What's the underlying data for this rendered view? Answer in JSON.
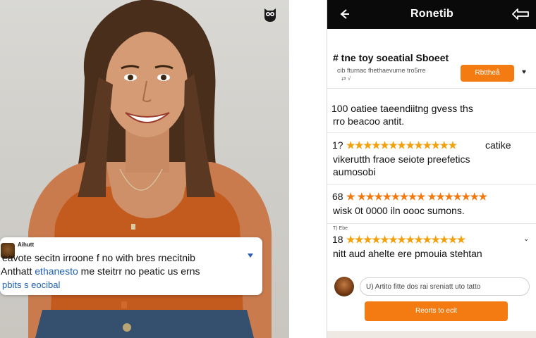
{
  "photo_panel": {
    "comment": {
      "author": "Aihutt",
      "line1": "eavote secitn irroone f no with bres rnecitnib",
      "line2_prefix": "Anthatt ",
      "line2_highlight": "ethanesto",
      "line2_suffix": " me steitrr no peatic us erns",
      "line3": "pbits s eocibal"
    }
  },
  "app": {
    "title": "Ronetib",
    "post": {
      "title": "# tne toy soeatial Sboeet",
      "meta": "cib fturnac fhethaevurne tro5rre",
      "meta2": "⇄ √",
      "follow_label": "Rbttheå",
      "more": "♥"
    },
    "items": [
      {
        "line1": "100 oatiee taeendiitng gvess ths",
        "line2": "rro beacoo antit."
      },
      {
        "prefix": "1?",
        "stars": "★★★★★★★★★★★★★",
        "suffix": "catike",
        "line2": "vikerutth fraoe seiote preefetics",
        "line3": "aumosobi"
      },
      {
        "prefix": "68",
        "stars": "★ ★★★★★★★★ ★★★★★★★",
        "line2": "wisk 0t 0000 iln oooc sumons."
      },
      {
        "small": "T) Ebe",
        "prefix": "18",
        "stars": "★★★★★★★★★★★★★★",
        "chev": "⌄",
        "line2": "nitt aud ahelte ere pmouia stehtan"
      }
    ],
    "reply": {
      "placeholder": "U) Artito fitte dos rai sreniatt uto tatto",
      "button_label": "Reorts to ecit"
    }
  },
  "colors": {
    "accent": "#f47a12",
    "star": "#f3a10b",
    "link": "#1e5fb4"
  }
}
